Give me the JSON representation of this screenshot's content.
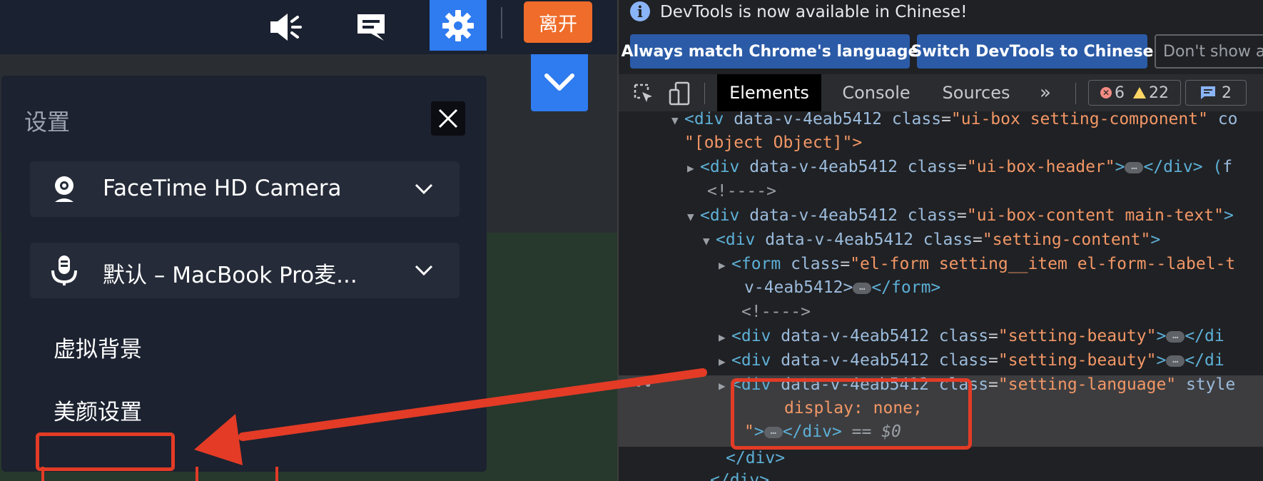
{
  "app": {
    "toolbar": {
      "leave_label": "离开"
    },
    "settings_panel": {
      "title": "设置",
      "camera": {
        "label": "FaceTime HD Camera"
      },
      "microphone": {
        "label": "默认 – MacBook Pro麦..."
      },
      "menu_items": [
        "虚拟背景",
        "美颜设置"
      ]
    }
  },
  "devtools": {
    "infobar": {
      "message": "DevTools is now available in Chinese!",
      "buttons": [
        "Always match Chrome's language",
        "Switch DevTools to Chinese",
        "Don't show again"
      ]
    },
    "tabs": [
      "Elements",
      "Console",
      "Sources"
    ],
    "more_tabs": "»",
    "issues": {
      "errors": "6",
      "warnings": "22"
    },
    "messages": "2",
    "dom_lines": {
      "l1_attr": "data-v-4eab5412",
      "l1_class_val": "\"ui-box setting-component\"",
      "l1_tail": "co",
      "l2": "\"[object Object]\">",
      "l3_class_val": "\"ui-box-header\"",
      "l3_tail": "f",
      "l4": "<!---->",
      "l5_class_val": "\"ui-box-content main-text\"",
      "l6_class_val": "\"setting-content\"",
      "l7_class_val": "\"el-form setting__item el-form--label-t",
      "l8": "v-4eab5412>",
      "l9": "<!---->",
      "l10_class_val": "\"setting-beauty\"",
      "l10_tail": "</di",
      "l11_class_val": "\"setting-beauty\"",
      "l11_tail": "</di",
      "l12_class_val": "\"setting-language\"",
      "l12_tail": "style",
      "l13": "display: none;",
      "l14_sel": "== $0",
      "l15": "</div>"
    }
  },
  "colors": {
    "accent_blue": "#2f7bf0",
    "leave_orange": "#ef6c2a",
    "annotation_red": "#e33b26"
  }
}
